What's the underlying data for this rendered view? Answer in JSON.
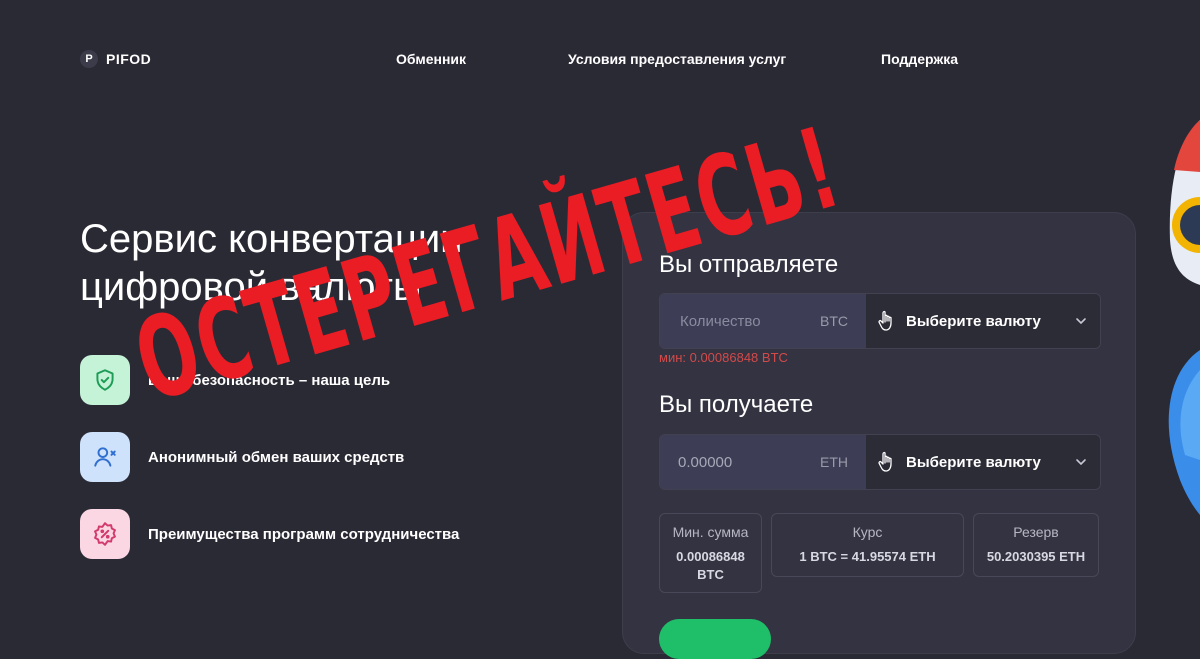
{
  "header": {
    "logo_mark": "P",
    "logo_text": "PIFOD",
    "nav": [
      "Обменник",
      "Условия предоставления услуг",
      "Поддержка"
    ]
  },
  "hero": {
    "title_line1": "Сервис конвертации",
    "title_line2": "цифровой валюты"
  },
  "features": [
    {
      "icon": "shield-check-icon",
      "label": "Ваша безопасность – наша цель",
      "bg": "#c5f3d7",
      "fg": "#1c9c55"
    },
    {
      "icon": "user-x-icon",
      "label": "Анонимный обмен ваших средств",
      "bg": "#cfe2fb",
      "fg": "#2f6fd0"
    },
    {
      "icon": "percent-badge-icon",
      "label": "Преимущества программ сотрудничества",
      "bg": "#fbd7e4",
      "fg": "#d23a6c"
    }
  ],
  "exchange": {
    "send_heading": "Вы отправляете",
    "send_placeholder": "Количество",
    "send_unit": "BTC",
    "send_select": "Выберите валюту",
    "min_note": "мин: 0.00086848 BTC",
    "receive_heading": "Вы получаете",
    "receive_value": "0.00000",
    "receive_unit": "ETH",
    "receive_select": "Выберите валюту",
    "stats": [
      {
        "key": "Мин. сумма",
        "value_line1": "0.00086848",
        "value_line2": "BTC"
      },
      {
        "key": "Курс",
        "value_line1": "1 BTC = 41.95574 ETH",
        "value_line2": ""
      },
      {
        "key": "Резерв",
        "value_line1": "50.2030395 ETH",
        "value_line2": ""
      }
    ]
  },
  "overlay": {
    "warning_text": "ОСТЕРЕГАЙТЕСЬ!"
  },
  "colors": {
    "background": "#2a2a35",
    "warning": "#ea1c24",
    "accent_green": "#1fbf6a",
    "error": "#d24a4a"
  }
}
